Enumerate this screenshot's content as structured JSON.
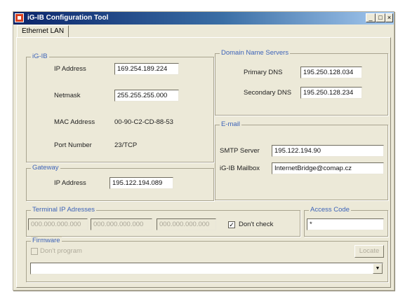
{
  "window": {
    "title": "iG-IB Configuration Tool",
    "controls": {
      "minimize": "_",
      "maximize": "□",
      "close": "×"
    }
  },
  "tabs": [
    {
      "label": "Ethernet LAN",
      "active": true
    }
  ],
  "igib": {
    "legend": "iG-IB",
    "ip_label": "IP Address",
    "ip_value": "169.254.189.224",
    "netmask_label": "Netmask",
    "netmask_value": "255.255.255.000",
    "mac_label": "MAC Address",
    "mac_value": "00-90-C2-CD-88-53",
    "port_label": "Port Number",
    "port_value": "23/TCP"
  },
  "gateway": {
    "legend": "Gateway",
    "ip_label": "IP Address",
    "ip_value": "195.122.194.089"
  },
  "dns": {
    "legend": "Domain Name Servers",
    "primary_label": "Primary DNS",
    "primary_value": "195.250.128.034",
    "secondary_label": "Secondary DNS",
    "secondary_value": "195.250.128.234"
  },
  "email": {
    "legend": "E-mail",
    "smtp_label": "SMTP Server",
    "smtp_value": "195.122.194.90",
    "mailbox_label": "iG-IB Mailbox",
    "mailbox_value": "InternetBridge@comap.cz"
  },
  "terminal": {
    "legend": "Terminal IP Adresses",
    "fields": [
      "000.000.000.000",
      "000.000.000.000",
      "000.000.000.000"
    ],
    "dont_check_label": "Don't check",
    "dont_check_checked": true
  },
  "access_code": {
    "legend": "Access Code",
    "value": "*"
  },
  "firmware": {
    "legend": "Firmware",
    "dont_program_label": "Don't program",
    "locate_label": "Locate",
    "path_value": "",
    "dropdown_arrow": "▼"
  },
  "colors": {
    "title_gradient_start": "#0a246a",
    "legend_blue": "#3d63b8",
    "window_bg": "#ece9d8"
  }
}
